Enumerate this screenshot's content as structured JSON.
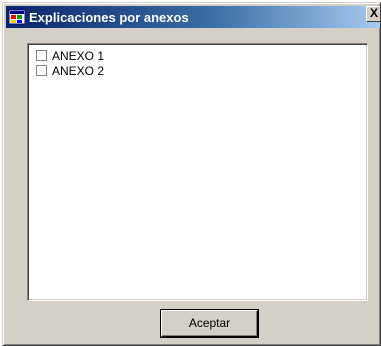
{
  "window": {
    "title": "Explicaciones por anexos",
    "close_glyph": "X",
    "icon": "app-window-icon"
  },
  "list": {
    "items": [
      {
        "label": "ANEXO 1",
        "checked": false
      },
      {
        "label": "ANEXO 2",
        "checked": false
      }
    ]
  },
  "buttons": {
    "accept_label": "Aceptar"
  },
  "colors": {
    "title_gradient_start": "#0a246a",
    "title_gradient_end": "#a6caf0",
    "face": "#d4d0c8"
  }
}
